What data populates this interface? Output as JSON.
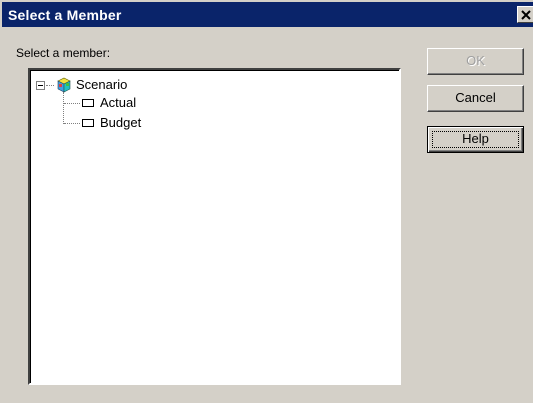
{
  "window": {
    "title": "Select a Member",
    "close_glyph": "close-icon"
  },
  "prompt": "Select a member:",
  "tree": {
    "root": {
      "label": "Scenario",
      "icon": "cube-dimension-icon",
      "expanded": true
    },
    "children": [
      {
        "label": "Actual",
        "icon": "member-leaf-icon"
      },
      {
        "label": "Budget",
        "icon": "member-leaf-icon"
      }
    ]
  },
  "buttons": {
    "ok": "OK",
    "cancel": "Cancel",
    "help": "Help"
  },
  "colors": {
    "title_bar": "#0a246a",
    "dialog_face": "#d4d0c8"
  }
}
